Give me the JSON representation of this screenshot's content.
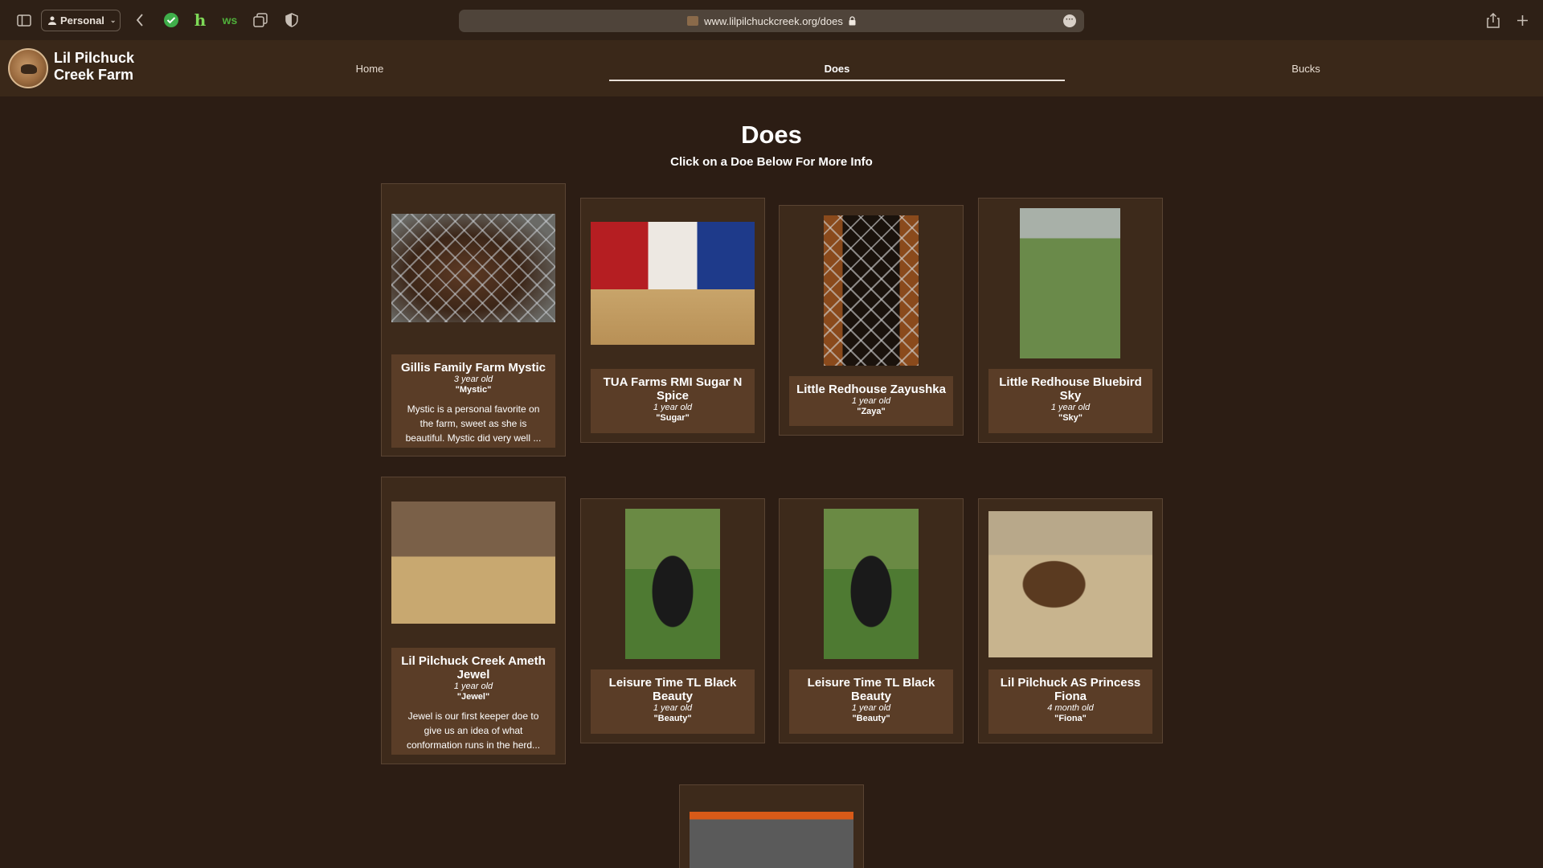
{
  "browser": {
    "profile_label": "Personal",
    "url": "www.lilpilchuckcreek.org/does",
    "lock_icon": "lock-icon",
    "more_icon": "ellipsis-icon",
    "toolbar_icons": [
      "sidebar-icon",
      "back-icon",
      "check-extension-icon",
      "honey-extension-icon",
      "grammar-extension-icon",
      "tabs-icon",
      "shield-icon",
      "share-icon",
      "new-tab-icon"
    ]
  },
  "site": {
    "brand": "Lil Pilchuck Creek Farm",
    "nav": {
      "home": "Home",
      "does": "Does",
      "bucks": "Bucks"
    }
  },
  "page": {
    "title": "Does",
    "subtitle": "Click on a Doe Below For More Info"
  },
  "does": [
    {
      "name": "Gillis Family Farm Mystic",
      "age": "3 year old",
      "nickname": "\"Mystic\"",
      "description": "Mystic is a personal favorite on the farm, sweet as she is beautiful. Mystic did very well ..."
    },
    {
      "name": "TUA Farms RMI Sugar N Spice",
      "age": "1 year old",
      "nickname": "\"Sugar\"",
      "description": ""
    },
    {
      "name": "Little Redhouse Zayushka",
      "age": "1 year old",
      "nickname": "\"Zaya\"",
      "description": ""
    },
    {
      "name": "Little Redhouse Bluebird Sky",
      "age": "1 year old",
      "nickname": "\"Sky\"",
      "description": ""
    },
    {
      "name": "Lil Pilchuck Creek Ameth Jewel",
      "age": "1 year old",
      "nickname": "\"Jewel\"",
      "description": "Jewel is our first keeper doe to give us an idea of what conformation runs in the herd..."
    },
    {
      "name": "Leisure Time TL Black Beauty",
      "age": "1 year old",
      "nickname": "\"Beauty\"",
      "description": ""
    },
    {
      "name": "Leisure Time TL Black Beauty",
      "age": "1 year old",
      "nickname": "\"Beauty\"",
      "description": ""
    },
    {
      "name": "Lil Pilchuck AS Princess Fiona",
      "age": "4 month old",
      "nickname": "\"Fiona\"",
      "description": ""
    }
  ]
}
